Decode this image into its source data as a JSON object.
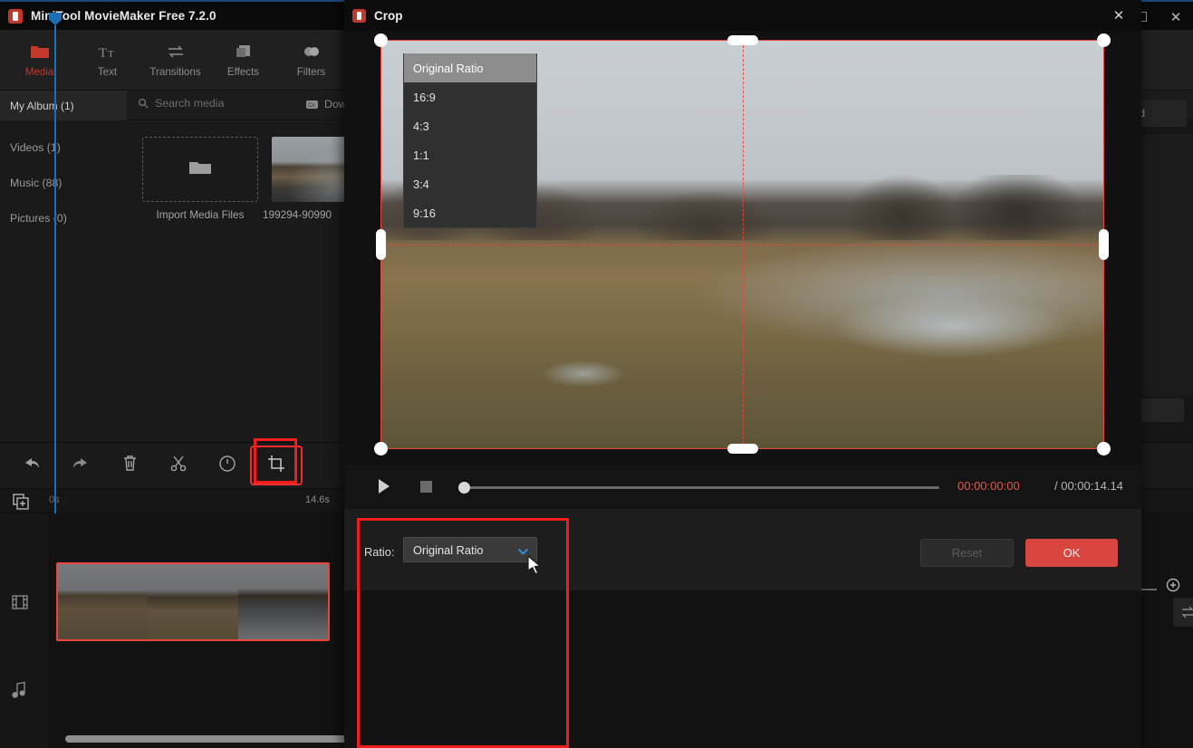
{
  "app": {
    "title": "MiniTool MovieMaker Free 7.2.0",
    "logo_icon": "minitool-logo-icon",
    "window_controls": {
      "maximize": "☐",
      "close": "✕"
    }
  },
  "ribbon": {
    "items": [
      {
        "label": "Media",
        "icon": "folder-icon",
        "active": true
      },
      {
        "label": "Text",
        "icon": "text-icon",
        "active": false
      },
      {
        "label": "Transitions",
        "icon": "transitions-icon",
        "active": false
      },
      {
        "label": "Effects",
        "icon": "effects-icon",
        "active": false
      },
      {
        "label": "Filters",
        "icon": "filters-icon",
        "active": false
      }
    ]
  },
  "media_panel": {
    "album_tab": "My Album (1)",
    "search_placeholder": "Search media",
    "search_icon": "search-icon",
    "download_label": "Dow",
    "download_icon": "download-icon",
    "categories": [
      {
        "label": "Videos (1)"
      },
      {
        "label": "Music (88)"
      },
      {
        "label": "Pictures (0)"
      }
    ],
    "import_tile": {
      "label": "Import Media Files",
      "icon": "folder-open-icon"
    },
    "media_items": [
      {
        "name": "199294-90990"
      }
    ]
  },
  "preview_back": {
    "speed_label": "eed"
  },
  "edit_toolbar": {
    "buttons": [
      {
        "name": "undo",
        "icon": "undo-icon",
        "highlighted": false
      },
      {
        "name": "redo",
        "icon": "redo-icon",
        "highlighted": false
      },
      {
        "name": "delete",
        "icon": "trash-icon",
        "highlighted": false
      },
      {
        "name": "split",
        "icon": "scissors-icon",
        "highlighted": false
      },
      {
        "name": "speed",
        "icon": "speed-icon",
        "highlighted": false
      },
      {
        "name": "crop",
        "icon": "crop-icon",
        "highlighted": true
      }
    ]
  },
  "timeline": {
    "add_media_icon": "add-media-icon",
    "start_time": "0s",
    "end_time": "14.6s",
    "video_track_icon": "film-strip-icon",
    "audio_track_icon": "music-note-icon",
    "zoom_in_icon": "plus-icon"
  },
  "crop_dialog": {
    "title": "Crop",
    "logo_icon": "minitool-logo-icon",
    "close_icon": "✕",
    "crop_handles": [
      "top-left",
      "top-center",
      "top-right",
      "middle-left",
      "middle-right",
      "bottom-left",
      "bottom-center",
      "bottom-right"
    ],
    "player": {
      "play_icon": "play-icon",
      "stop_icon": "stop-icon",
      "current_time": "00:00:00:00",
      "total_time": "/ 00:00:14.14",
      "current_time_color": "#e05a4f"
    },
    "ratio": {
      "label": "Ratio:",
      "selected": "Original Ratio",
      "chevron_icon": "chevron-down-icon",
      "chevron_color": "#2f8fe0",
      "options": [
        {
          "label": "Original Ratio",
          "selected": true
        },
        {
          "label": "16:9",
          "selected": false
        },
        {
          "label": "4:3",
          "selected": false
        },
        {
          "label": "1:1",
          "selected": false
        },
        {
          "label": "3:4",
          "selected": false
        },
        {
          "label": "9:16",
          "selected": false
        }
      ]
    },
    "reset_label": "Reset",
    "reset_enabled": false,
    "ok_label": "OK",
    "ok_color": "#d9453f"
  },
  "annotation_color": "#f01d1d"
}
